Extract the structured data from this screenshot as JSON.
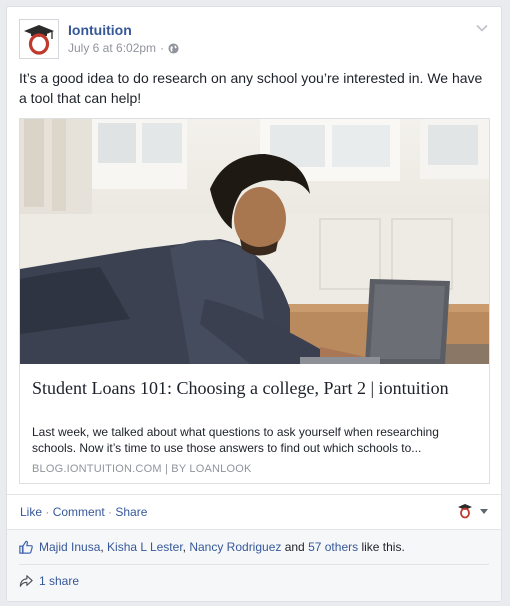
{
  "post": {
    "author": "Iontuition",
    "timestamp": "July 6 at 6:02pm",
    "separator": "·",
    "privacy_icon": "globe-icon",
    "options_icon": "chevron-down-icon",
    "text": "It’s a good idea to do research on any school you’re interested in. We have a tool that can help!"
  },
  "link": {
    "image_alt": "Young man lying on the floor using a laptop",
    "title": "Student Loans 101: Choosing a college, Part 2 | iontuition",
    "description": "Last week, we talked about what questions to ask yourself when researching schools. Now it’s time to use those answers to find out which schools to...",
    "domain": "BLOG.IONTUITION.COM",
    "byline_sep": " | ",
    "byline": "BY LOANLOOK"
  },
  "actions": {
    "like": "Like",
    "comment": "Comment",
    "share": "Share",
    "sep": " · "
  },
  "ufi": {
    "liker_1": "Majid Inusa",
    "comma": ", ",
    "liker_2": "Kisha L Lester",
    "liker_3": "Nancy Rodriguez",
    "and": " and ",
    "others": "57 others",
    "like_suffix": " like this.",
    "shares": "1 share"
  },
  "colors": {
    "link_blue": "#365899",
    "meta_gray": "#90949c",
    "brand_red": "#c0392b"
  }
}
